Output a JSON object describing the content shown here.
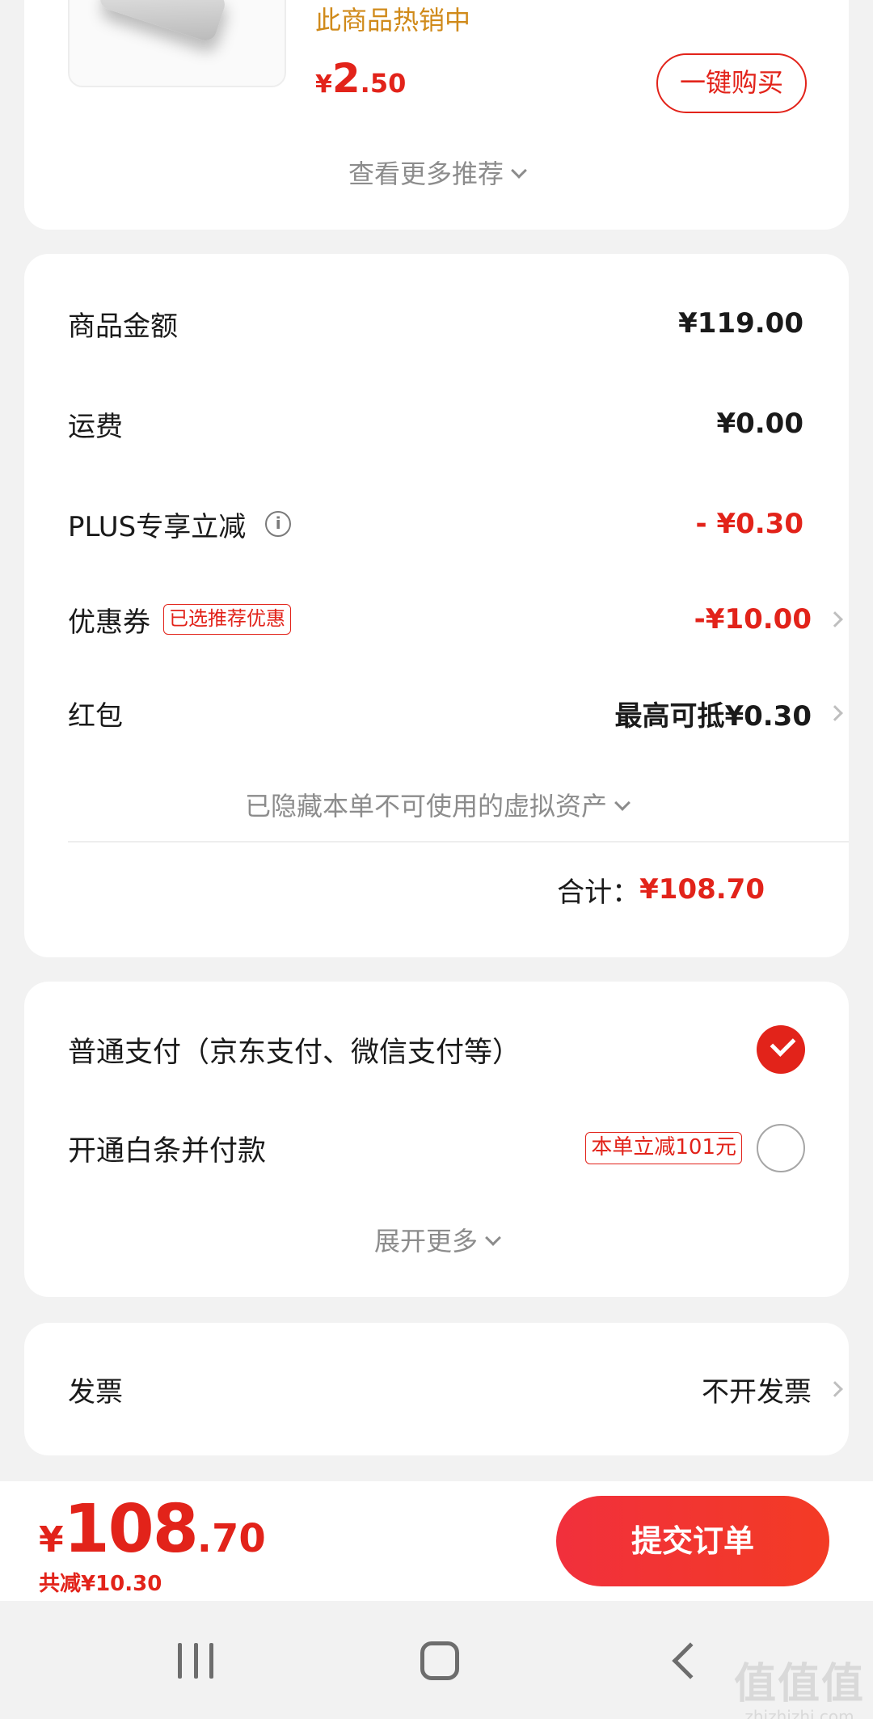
{
  "recommendation": {
    "hot_text": "此商品热销中",
    "price_symbol": "¥",
    "price_int": "2",
    "price_dec": ".50",
    "buy_button": "一键购买",
    "more_label": "查看更多推荐"
  },
  "summary": {
    "goods_amount_label": "商品金额",
    "goods_amount_value": "¥119.00",
    "shipping_label": "运费",
    "shipping_value": "¥0.00",
    "plus_label": "PLUS专享立减",
    "plus_value": "- ¥0.30",
    "coupon_label": "优惠券",
    "coupon_tag": "已选推荐优惠",
    "coupon_value": "-¥10.00",
    "redpacket_label": "红包",
    "redpacket_value": "最高可抵¥0.30",
    "hidden_assets_label": "已隐藏本单不可使用的虚拟资产",
    "total_label": "合计：",
    "total_value": "¥108.70"
  },
  "payment": {
    "normal_label": "普通支付（京东支付、微信支付等）",
    "normal_selected": true,
    "baitiao_label": "开通白条并付款",
    "baitiao_tag": "本单立减101元",
    "baitiao_selected": false,
    "expand_label": "展开更多"
  },
  "invoice": {
    "label": "发票",
    "value": "不开发票"
  },
  "bottom_bar": {
    "price_symbol": "¥",
    "price_int": "108",
    "price_dec": ".70",
    "saved": "共减¥10.30",
    "submit_label": "提交订单"
  },
  "watermark": {
    "logo": "值值值",
    "url": "zhizhizhi.com"
  },
  "colors": {
    "accent": "#e2231a",
    "hot_text": "#d08a1a",
    "background": "#f2f2f2",
    "muted_text": "#8c8c8c"
  }
}
